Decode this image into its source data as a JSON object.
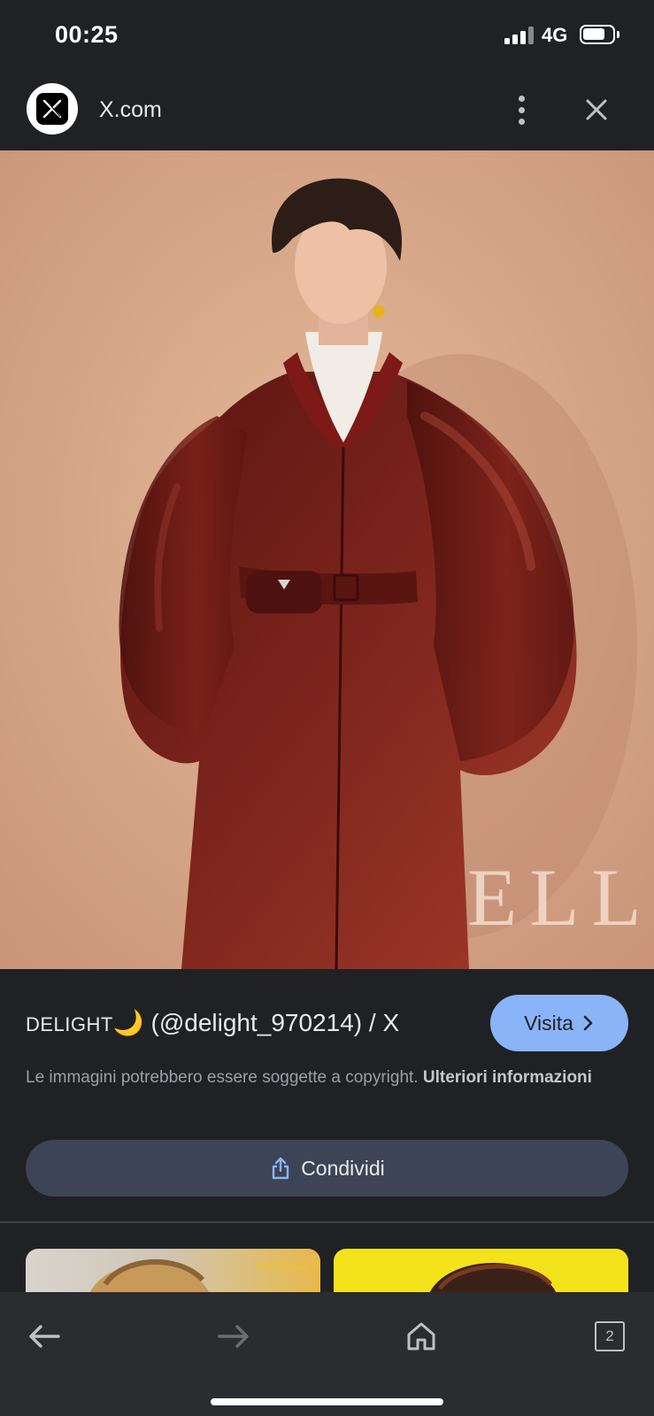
{
  "status_bar": {
    "time": "00:25",
    "network": "4G",
    "signal_bars": 4,
    "signal_bars_active": 3
  },
  "top_bar": {
    "site_name": "X.com",
    "logo_glyph": "𝕏",
    "more_icon": "vertical-dots-icon",
    "close_icon": "close-icon"
  },
  "hero": {
    "alt": "Foto: ragazzo con cappotto di pelle bordeaux con cintura e marsupio, dolcevita bianco, sfondo pesca",
    "watermark": "ELLE",
    "colors": {
      "background": "#d8a88a",
      "coat": "#6e1d18",
      "turtleneck": "#f2ece6"
    }
  },
  "result": {
    "title_prefix": "DELIGHT",
    "title_emoji": "🌙",
    "title_rest": " (@delight_970214) / X",
    "visit_label": "Visita",
    "copyright_text": "Le immagini potrebbero essere soggette a copyright. ",
    "copyright_link": "Ulteriori informazioni",
    "share_label": "Condividi",
    "accent_color": "#8ab4f8"
  },
  "related": {
    "thumb1_text": "BANANA FISH"
  },
  "bottom_nav": {
    "tab_count": "2",
    "back_icon": "arrow-left-icon",
    "forward_icon": "arrow-right-icon",
    "home_icon": "home-icon",
    "tabs_icon": "tabs-icon"
  }
}
